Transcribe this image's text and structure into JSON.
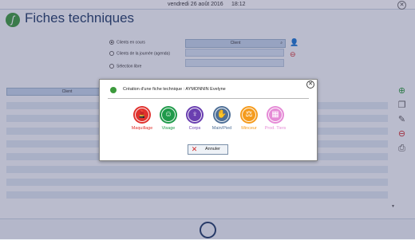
{
  "header": {
    "date": "vendredi 26 août 2016",
    "time": "18:12",
    "close": "✕"
  },
  "app": {
    "title": "Fiches techniques"
  },
  "filters": {
    "options": [
      {
        "label": "Clients en cours",
        "selected": true
      },
      {
        "label": "Clients de la journée (agenda)",
        "selected": false
      },
      {
        "label": "Sélection libre",
        "selected": false
      }
    ],
    "client_header": "Client"
  },
  "grid": {
    "column_header": "Client"
  },
  "dialog": {
    "title": "Création d'une fiche technique : AYMONNIN Evelyne",
    "close": "✕",
    "categories": [
      {
        "label": "Maquillage",
        "color": "#e0322e",
        "glyph": "💄"
      },
      {
        "label": "Visage",
        "color": "#1f9a4a",
        "glyph": "☺"
      },
      {
        "label": "Corps",
        "color": "#6a3fb0",
        "glyph": "♀"
      },
      {
        "label": "Main/Pied",
        "color": "#4e6f96",
        "glyph": "✋"
      },
      {
        "label": "Minceur",
        "color": "#f59b1c",
        "glyph": "⚖"
      },
      {
        "label": "Prod. Tiers",
        "color": "#e58bd6",
        "glyph": "▦"
      }
    ],
    "cancel_label": "Annuler"
  },
  "colors": {
    "accent": "#1f3b66",
    "brand_green": "#3c9a3c"
  }
}
